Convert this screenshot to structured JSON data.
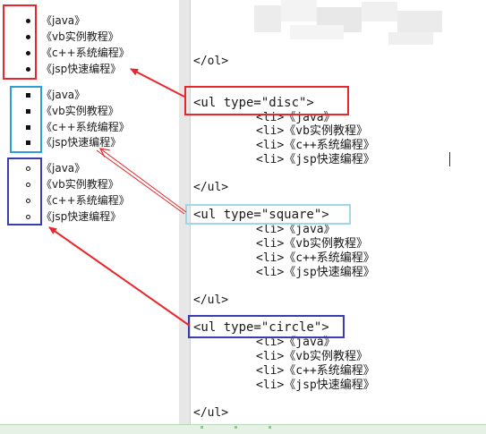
{
  "left_panel": {
    "lists": [
      {
        "style": "disc",
        "items": [
          "《java》",
          "《vb实例教程》",
          "《c++系统编程》",
          "《jsp快速编程》"
        ]
      },
      {
        "style": "square",
        "items": [
          "《java》",
          "《vb实例教程》",
          "《c++系统编程》",
          "《jsp快速编程》"
        ]
      },
      {
        "style": "circle",
        "items": [
          "《java》",
          "《vb实例教程》",
          "《c++系统编程》",
          "《jsp快速编程》"
        ]
      }
    ]
  },
  "code_panel": {
    "ol_close": "</ol>",
    "ul_close": "</ul>",
    "ul_open_disc": "<ul type=\"disc\">",
    "ul_open_square": "<ul type=\"square\">",
    "ul_open_circle": "<ul type=\"circle\">",
    "li_lines": [
      "<li>《java》",
      "<li>《vb实例教程》",
      "<li>《c++系统编程》",
      "<li>《jsp快速编程》"
    ]
  },
  "annotation_colors": {
    "disc": "#e8262b",
    "square": "#2aa0d6",
    "square_code": "#9fd6e8",
    "circle": "#3a3db0",
    "arrow": "#e8262b"
  }
}
